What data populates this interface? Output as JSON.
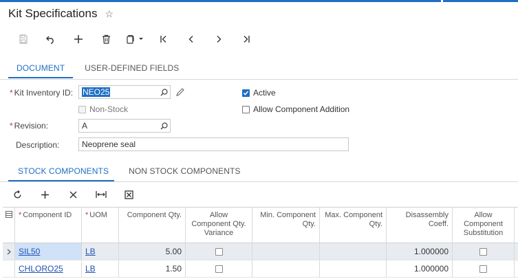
{
  "header": {
    "title": "Kit Specifications"
  },
  "tabs": [
    {
      "label": "DOCUMENT",
      "active": true
    },
    {
      "label": "USER-DEFINED FIELDS",
      "active": false
    }
  ],
  "form": {
    "kit_inventory_id": {
      "label": "Kit Inventory ID:",
      "value": "NEO25"
    },
    "non_stock": {
      "label": "Non-Stock",
      "checked": false
    },
    "active": {
      "label": "Active",
      "checked": true
    },
    "allow_component_addition": {
      "label": "Allow Component Addition",
      "checked": false
    },
    "revision": {
      "label": "Revision:",
      "value": "A"
    },
    "description": {
      "label": "Description:",
      "value": "Neoprene seal"
    }
  },
  "subtabs": [
    {
      "label": "STOCK COMPONENTS",
      "active": true
    },
    {
      "label": "NON STOCK COMPONENTS",
      "active": false
    }
  ],
  "grid": {
    "columns": {
      "component_id": "Component ID",
      "uom": "UOM",
      "component_qty": "Component Qty.",
      "allow_qty_variance": "Allow Component Qty. Variance",
      "min_qty": "Min. Component Qty.",
      "max_qty": "Max. Component Qty.",
      "disassembly_coeff": "Disassembly Coeff.",
      "allow_substitution": "Allow Component Substitution"
    },
    "rows": [
      {
        "component_id": "SIL50",
        "uom": "LB",
        "component_qty": "5.00",
        "allow_qty_variance": false,
        "min_qty": "",
        "max_qty": "",
        "disassembly_coeff": "1.000000",
        "allow_substitution": false
      },
      {
        "component_id": "CHLORO25",
        "uom": "LB",
        "component_qty": "1.50",
        "allow_qty_variance": false,
        "min_qty": "",
        "max_qty": "",
        "disassembly_coeff": "1.000000",
        "allow_substitution": false
      }
    ]
  },
  "colors": {
    "accent": "#1f6fc5",
    "link": "#1f50b5",
    "required": "#c0392b"
  }
}
